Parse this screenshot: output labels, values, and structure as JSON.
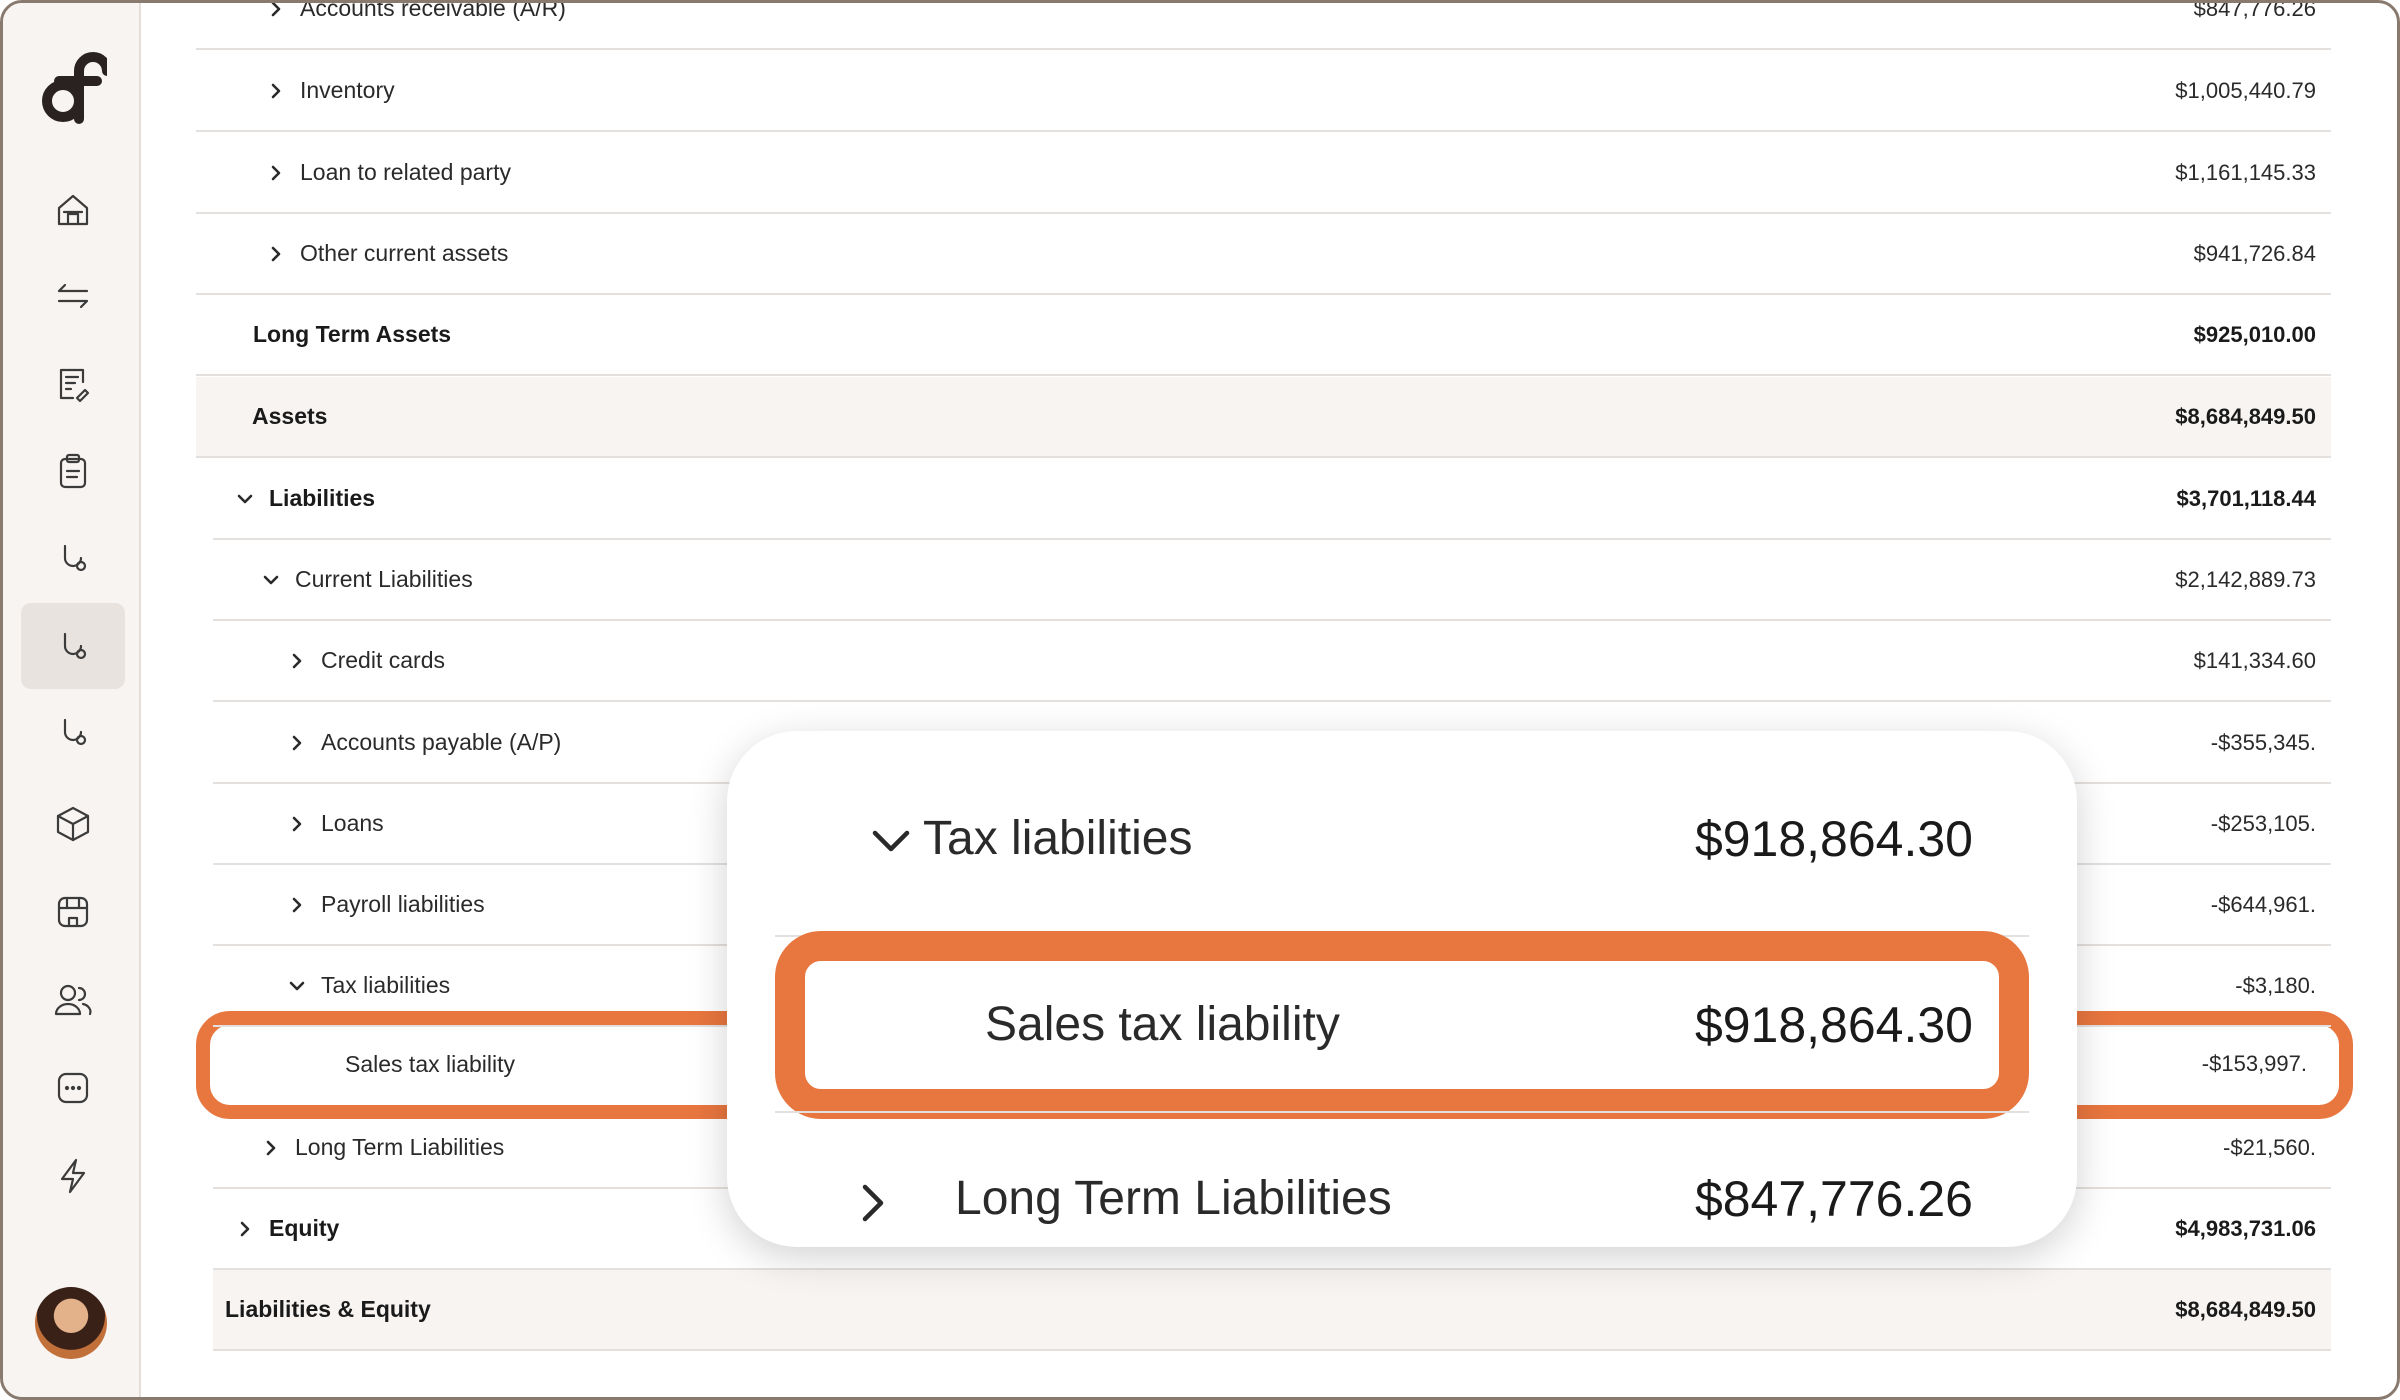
{
  "sidebar": {
    "items": [
      {
        "icon": "home-icon"
      },
      {
        "icon": "transfer-arrows-icon"
      },
      {
        "icon": "document-edit-icon"
      },
      {
        "icon": "clipboard-icon"
      },
      {
        "icon": "stethoscope-icon"
      },
      {
        "icon": "stethoscope-icon",
        "active": true
      },
      {
        "icon": "stethoscope-icon"
      },
      {
        "icon": "package-icon"
      },
      {
        "icon": "store-icon"
      },
      {
        "icon": "users-icon"
      },
      {
        "icon": "chat-icon"
      },
      {
        "icon": "lightning-icon"
      }
    ],
    "avatar": "avatar"
  },
  "report": {
    "rows": [
      {
        "label": "Accounts receivable (A/R)",
        "amount": "$847,776.26"
      },
      {
        "label": "Inventory",
        "amount": "$1,005,440.79"
      },
      {
        "label": "Loan to related party",
        "amount": "$1,161,145.33"
      },
      {
        "label": "Other current assets",
        "amount": "$941,726.84"
      },
      {
        "label": "Long Term Assets",
        "amount": "$925,010.00"
      },
      {
        "label": "Assets",
        "amount": "$8,684,849.50"
      },
      {
        "label": "Liabilities",
        "amount": "$3,701,118.44"
      },
      {
        "label": "Current Liabilities",
        "amount": "$2,142,889.73"
      },
      {
        "label": "Credit cards",
        "amount": "$141,334.60"
      },
      {
        "label": "Accounts payable (A/P)",
        "amount": "-$355,345."
      },
      {
        "label": "Loans",
        "amount": "-$253,105."
      },
      {
        "label": "Payroll liabilities",
        "amount": "-$644,961."
      },
      {
        "label": "Tax liabilities",
        "amount": "-$3,180."
      },
      {
        "label": "Sales tax liability",
        "amount": "-$153,997."
      },
      {
        "label": "Long Term Liabilities",
        "amount": "-$21,560."
      },
      {
        "label": "Equity",
        "amount": "$4,983,731.06"
      },
      {
        "label": "Liabilities & Equity",
        "amount": "$8,684,849.50"
      }
    ]
  },
  "callout": {
    "tax_liabilities_label": "Tax liabilities",
    "tax_liabilities_amount": "$918,864.30",
    "sales_tax_label": "Sales tax liability",
    "sales_tax_amount": "$918,864.30",
    "long_term_label": "Long Term Liabilities",
    "long_term_amount": "$847,776.26"
  },
  "colors": {
    "highlight": "#e8763f",
    "sidebar_bg": "#f7f4f2",
    "shaded_row": "#f7f4f2"
  }
}
